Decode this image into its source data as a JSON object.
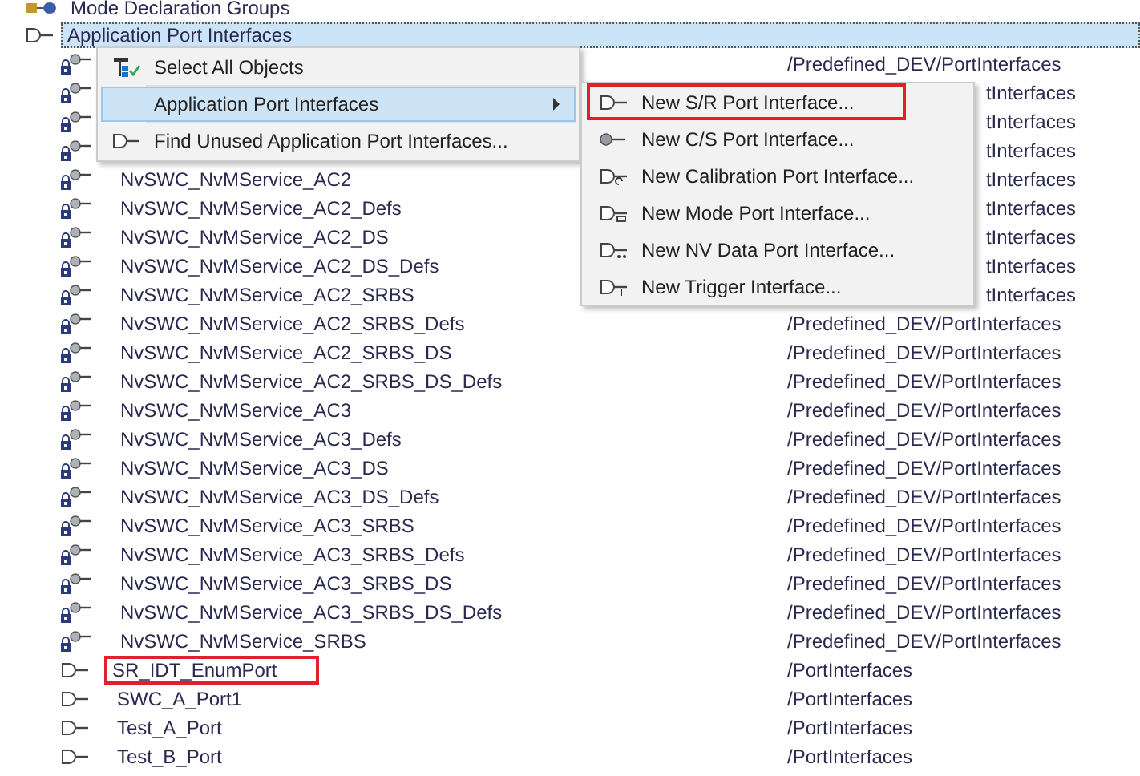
{
  "tree": [
    {
      "label": "Mode Declaration Groups",
      "kind": "mode-groups",
      "selected": false
    },
    {
      "label": "Application Port Interfaces",
      "kind": "sr",
      "selected": true,
      "children": [
        {
          "kind": "locked-cs",
          "path": "/Predefined_DEV/PortInterfaces",
          "path_cut": false
        },
        {
          "kind": "locked-cs",
          "path": "tInterfaces",
          "path_cut": true
        },
        {
          "kind": "locked-cs",
          "path": "tInterfaces",
          "path_cut": true
        },
        {
          "kind": "locked-cs",
          "path": "tInterfaces",
          "path_cut": true
        },
        {
          "name": "NvSWC_NvMService_AC2",
          "kind": "locked-cs",
          "path": "tInterfaces",
          "path_cut": true,
          "annotated": false
        },
        {
          "name": "NvSWC_NvMService_AC2_Defs",
          "kind": "locked-cs",
          "path": "tInterfaces",
          "path_cut": true,
          "annotated": false
        },
        {
          "name": "NvSWC_NvMService_AC2_DS",
          "kind": "locked-cs",
          "path": "tInterfaces",
          "path_cut": true,
          "annotated": false
        },
        {
          "name": "NvSWC_NvMService_AC2_DS_Defs",
          "kind": "locked-cs",
          "path": "tInterfaces",
          "path_cut": true,
          "annotated": false
        },
        {
          "name": "NvSWC_NvMService_AC2_SRBS",
          "kind": "locked-cs",
          "path": "tInterfaces",
          "path_cut": true,
          "annotated": false
        },
        {
          "name": "NvSWC_NvMService_AC2_SRBS_Defs",
          "kind": "locked-cs",
          "path": "/Predefined_DEV/PortInterfaces",
          "path_cut": false,
          "annotated": false
        },
        {
          "name": "NvSWC_NvMService_AC2_SRBS_DS",
          "kind": "locked-cs",
          "path": "/Predefined_DEV/PortInterfaces",
          "path_cut": false,
          "annotated": false
        },
        {
          "name": "NvSWC_NvMService_AC2_SRBS_DS_Defs",
          "kind": "locked-cs",
          "path": "/Predefined_DEV/PortInterfaces",
          "path_cut": false,
          "annotated": false
        },
        {
          "name": "NvSWC_NvMService_AC3",
          "kind": "locked-cs",
          "path": "/Predefined_DEV/PortInterfaces",
          "path_cut": false,
          "annotated": false
        },
        {
          "name": "NvSWC_NvMService_AC3_Defs",
          "kind": "locked-cs",
          "path": "/Predefined_DEV/PortInterfaces",
          "path_cut": false,
          "annotated": false
        },
        {
          "name": "NvSWC_NvMService_AC3_DS",
          "kind": "locked-cs",
          "path": "/Predefined_DEV/PortInterfaces",
          "path_cut": false,
          "annotated": false
        },
        {
          "name": "NvSWC_NvMService_AC3_DS_Defs",
          "kind": "locked-cs",
          "path": "/Predefined_DEV/PortInterfaces",
          "path_cut": false,
          "annotated": false
        },
        {
          "name": "NvSWC_NvMService_AC3_SRBS",
          "kind": "locked-cs",
          "path": "/Predefined_DEV/PortInterfaces",
          "path_cut": false,
          "annotated": false
        },
        {
          "name": "NvSWC_NvMService_AC3_SRBS_Defs",
          "kind": "locked-cs",
          "path": "/Predefined_DEV/PortInterfaces",
          "path_cut": false,
          "annotated": false
        },
        {
          "name": "NvSWC_NvMService_AC3_SRBS_DS",
          "kind": "locked-cs",
          "path": "/Predefined_DEV/PortInterfaces",
          "path_cut": false,
          "annotated": false
        },
        {
          "name": "NvSWC_NvMService_AC3_SRBS_DS_Defs",
          "kind": "locked-cs",
          "path": "/Predefined_DEV/PortInterfaces",
          "path_cut": false,
          "annotated": false
        },
        {
          "name": "NvSWC_NvMService_SRBS",
          "kind": "locked-cs",
          "path": "/Predefined_DEV/PortInterfaces",
          "path_cut": false,
          "annotated": false
        },
        {
          "name": "SR_IDT_EnumPort",
          "kind": "sr",
          "path": "/PortInterfaces",
          "path_cut": false,
          "annotated": true
        },
        {
          "name": "SWC_A_Port1",
          "kind": "sr",
          "path": "/PortInterfaces",
          "path_cut": false,
          "annotated": false
        },
        {
          "name": "Test_A_Port",
          "kind": "sr",
          "path": "/PortInterfaces",
          "path_cut": false,
          "annotated": false
        },
        {
          "name": "Test_B_Port",
          "kind": "sr",
          "path": "/PortInterfaces",
          "path_cut": false,
          "annotated": false
        }
      ]
    }
  ],
  "context_menu": {
    "items": [
      {
        "label": "Select All Objects",
        "kind": "select-all",
        "selected": false,
        "submenu": false
      },
      {
        "label": "Application Port Interfaces",
        "kind": "plain",
        "selected": true,
        "submenu": true
      },
      {
        "label": "Find Unused Application Port Interfaces...",
        "kind": "sr",
        "selected": false,
        "submenu": false
      }
    ]
  },
  "submenu": {
    "items": [
      {
        "label": "New S/R Port Interface...",
        "kind": "sr",
        "annotated": true
      },
      {
        "label": "New C/S Port Interface...",
        "kind": "cs",
        "annotated": false
      },
      {
        "label": "New Calibration Port Interface...",
        "kind": "calibration",
        "annotated": false
      },
      {
        "label": "New Mode Port Interface...",
        "kind": "mode",
        "annotated": false
      },
      {
        "label": "New NV Data Port Interface...",
        "kind": "nvdata",
        "annotated": false
      },
      {
        "label": "New Trigger Interface...",
        "kind": "trigger",
        "annotated": false
      }
    ]
  }
}
